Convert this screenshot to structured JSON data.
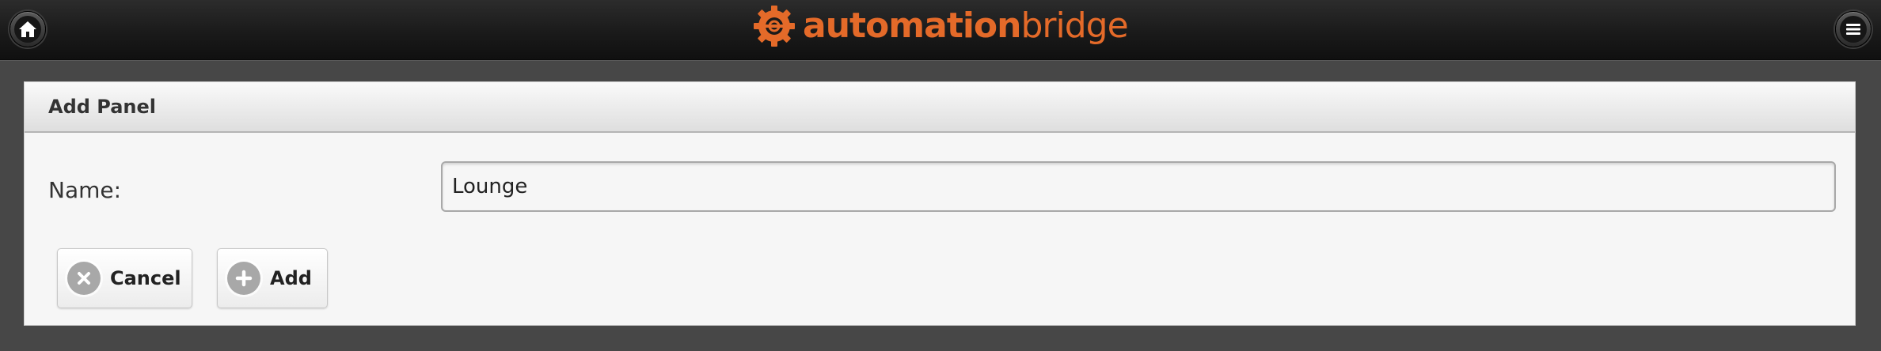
{
  "header": {
    "logo_bold": "automation",
    "logo_light": "bridge",
    "brand_color": "#e46a29",
    "home_icon": "home-icon",
    "menu_icon": "hamburger-menu-icon"
  },
  "panel": {
    "title": "Add Panel",
    "name_label": "Name:",
    "name_value": "Lounge"
  },
  "actions": {
    "cancel_label": "Cancel",
    "cancel_icon": "close-circle-icon",
    "add_label": "Add",
    "add_icon": "plus-circle-icon"
  }
}
